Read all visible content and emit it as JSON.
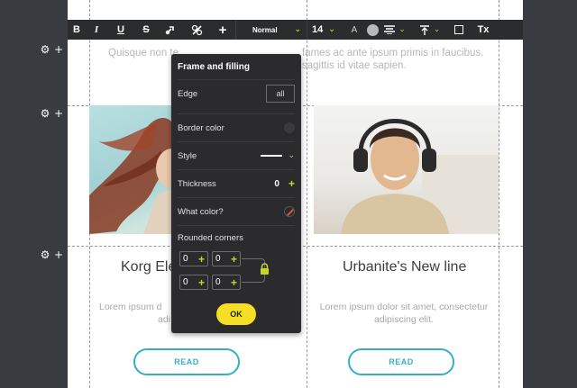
{
  "toolbar": {
    "bold": "B",
    "italic": "I",
    "underline": "U",
    "strikethrough": "S",
    "paragraph_style": "Normal",
    "font_size": "14",
    "font_color_letter": "A",
    "clear_format": "Tx"
  },
  "intro": {
    "line1_left": "Quisque non te",
    "line1_right": "fames ac ante ipsum primis in faucibus.",
    "line2_right": "sagittis id vitae sapien."
  },
  "cards": [
    {
      "title": "Korg Ele",
      "desc_line1": "Lorem ipsum d",
      "desc_line2": "adi",
      "button": "READ"
    },
    {
      "title": "Urbanite's New line",
      "desc_line1": "Lorem ipsum dolor sit amet, consectetur",
      "desc_line2": "adipiscing elit.",
      "button": "READ"
    }
  ],
  "panel": {
    "title": "Frame and filling",
    "edge_label": "Edge",
    "edge_value": "all",
    "border_color_label": "Border color",
    "style_label": "Style",
    "thickness_label": "Thickness",
    "thickness_value": "0",
    "what_color_label": "What color?",
    "rounded_corners_label": "Rounded corners",
    "corners": [
      "0",
      "0",
      "0",
      "0"
    ],
    "ok_label": "OK"
  },
  "colors": {
    "accent": "#c4d52b",
    "ok_button": "#f5de24",
    "read_button": "#37aec6",
    "toolbar_bg": "#2b2c2e",
    "panel_bg": "#2b2b2d"
  }
}
